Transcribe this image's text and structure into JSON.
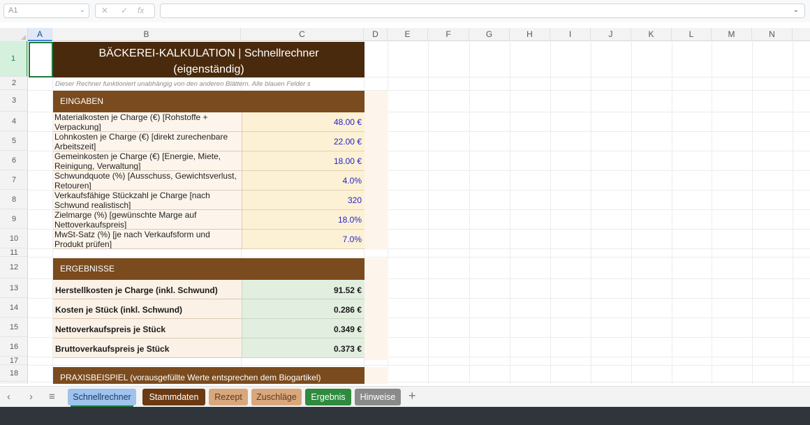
{
  "formula_bar": {
    "name_box": "A1",
    "cancel_glyph": "✕",
    "confirm_glyph": "✓",
    "fx_label": "fx",
    "formula": ""
  },
  "columns": [
    "A",
    "B",
    "C",
    "D",
    "E",
    "F",
    "G",
    "H",
    "I",
    "J",
    "K",
    "L",
    "M",
    "N"
  ],
  "selected_column": "A",
  "rows": [
    "1",
    "2",
    "3",
    "4",
    "5",
    "6",
    "7",
    "8",
    "9",
    "10",
    "11",
    "12",
    "13",
    "14",
    "15",
    "16",
    "17",
    "18"
  ],
  "selected_row": "1",
  "sheet": {
    "title_line1": "BÄCKEREI-KALKULATION  |  Schnellrechner",
    "title_line2": "(eigenständig)",
    "note": "Dieser Rechner funktioniert unabhängig von den anderen Blättern. Alle blauen Felder s",
    "inputs_header": "EINGABEN",
    "inputs": [
      {
        "line1": "Materialkosten je Charge (€)  [Rohstoffe +",
        "line2": "Verpackung]",
        "value": "48.00 €"
      },
      {
        "line1": "Lohnkosten je Charge (€)  [direkt zurechenbare",
        "line2": "Arbeitszeit]",
        "value": "22.00 €"
      },
      {
        "line1": "Gemeinkosten je Charge (€)  [Energie, Miete,",
        "line2": "Reinigung, Verwaltung]",
        "value": "18.00 €"
      },
      {
        "line1": "Schwundquote (%)  [Ausschuss, Gewichtsverlust,",
        "line2": "Retouren]",
        "value": "4.0%"
      },
      {
        "line1": "Verkaufsfähige Stückzahl je Charge  [nach",
        "line2": "Schwund realistisch]",
        "value": "320"
      },
      {
        "line1": "Zielmarge (%)  [gewünschte Marge auf",
        "line2": "Nettoverkaufspreis]",
        "value": "18.0%"
      },
      {
        "line1": "MwSt-Satz (%)  [je nach Verkaufsform und",
        "line2": "Produkt prüfen]",
        "value": "7.0%"
      }
    ],
    "results_header": "ERGEBNISSE",
    "results": [
      {
        "label": "Herstellkosten je Charge (inkl. Schwund)",
        "value": "91.52 €"
      },
      {
        "label": "Kosten je Stück (inkl. Schwund)",
        "value": "0.286 €"
      },
      {
        "label": "Nettoverkaufspreis je Stück",
        "value": "0.349 €"
      },
      {
        "label": "Bruttoverkaufspreis je Stück",
        "value": "0.373 €"
      }
    ],
    "example_header": "PRAXISBEISPIEL (vorausgefüllte Werte entsprechen dem Biogartikel)"
  },
  "tabs": [
    {
      "label": "Schnellrechner",
      "bg": "#9ec3ec",
      "fg": "#1a3c66"
    },
    {
      "label": "Stammdaten",
      "bg": "#6b3a12",
      "fg": "#ffffff"
    },
    {
      "label": "Rezept",
      "bg": "#d9a77c",
      "fg": "#5a3a1e"
    },
    {
      "label": "Zuschläge",
      "bg": "#d9a77c",
      "fg": "#5a3a1e"
    },
    {
      "label": "Ergebnis",
      "bg": "#2e8b3e",
      "fg": "#ffffff"
    },
    {
      "label": "Hinweise",
      "bg": "#8a8a8a",
      "fg": "#ffffff"
    }
  ],
  "active_tab": "Schnellrechner",
  "tab_add_glyph": "+",
  "tab_prev_glyph": "‹",
  "tab_next_glyph": "›",
  "tab_menu_glyph": "≡",
  "colors": {
    "title_bg": "#4a2a0d",
    "section_bg": "#7a4b1e",
    "input_text": "#2222cc",
    "input_bg": "#fdf1d5",
    "result_bg": "#e2efe0"
  }
}
